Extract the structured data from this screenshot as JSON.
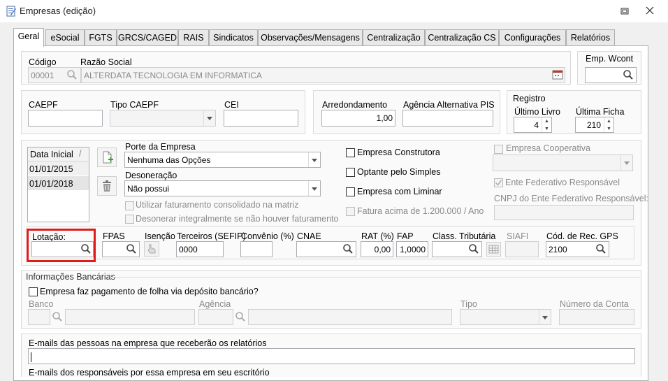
{
  "window": {
    "title": "Empresas (edição)"
  },
  "tabs": [
    {
      "label": "Geral"
    },
    {
      "label": "eSocial"
    },
    {
      "label": "FGTS"
    },
    {
      "label": "GRCS/CAGED"
    },
    {
      "label": "RAIS"
    },
    {
      "label": "Sindicatos"
    },
    {
      "label": "Observações/Mensagens"
    },
    {
      "label": "Centralização"
    },
    {
      "label": "Centralização CS"
    },
    {
      "label": "Configurações"
    },
    {
      "label": "Relatórios"
    }
  ],
  "company": {
    "codigo_label": "Código",
    "codigo_value": "00001",
    "razao_label": "Razão Social",
    "razao_value": "ALTERDATA TECNOLOGIA EM INFORMATICA",
    "wcont_label": "Emp. Wcont",
    "wcont_value": ""
  },
  "ids": {
    "caepf_label": "CAEPF",
    "caepf_value": "",
    "tipo_caepf_label": "Tipo CAEPF",
    "tipo_caepf_value": "",
    "cei_label": "CEI",
    "cei_value": ""
  },
  "arred": {
    "arred_label": "Arredondamento",
    "arred_value": "1,00",
    "agencia_pis_label": "Agência Alternativa PIS",
    "agencia_pis_value": ""
  },
  "registro": {
    "title": "Registro",
    "ultimo_livro_label": "Último Livro",
    "ultimo_livro_value": "4",
    "ultima_ficha_label": "Última Ficha",
    "ultima_ficha_value": "210"
  },
  "datas": {
    "header": "Data Inicial",
    "rows": [
      "01/01/2015",
      "01/01/2018"
    ]
  },
  "porte": {
    "label": "Porte da Empresa",
    "value": "Nenhuma das Opções"
  },
  "desoneracao": {
    "label": "Desoneração",
    "value": "Não possui"
  },
  "options": {
    "utilizar_fat": "Utilizar faturamento consolidado na matriz",
    "desonerar": "Desonerar integralmente se não houver faturamento",
    "construtora": "Empresa Construtora",
    "simples": "Optante pelo Simples",
    "liminar": "Empresa com Liminar",
    "fatura_acima": "Fatura acima de 1.200.000 / Ano",
    "cooperativa": "Empresa Cooperativa",
    "cooperativa_value": "",
    "ente_federativo": "Ente Federativo Responsável",
    "cnpj_ente_label": "CNPJ do Ente Federativo Responsável:",
    "cnpj_ente_value": ""
  },
  "fiscal": {
    "lotacao_label": "Lotação:",
    "lotacao_value": "",
    "fpas_label": "FPAS",
    "fpas_value": "",
    "isencao_label": "Isenção",
    "terceiros_label": "Terceiros (SEFIP)",
    "terceiros_value": "0000",
    "convenio_label": "Convênio (%)",
    "convenio_value": "",
    "cnae_label": "CNAE",
    "cnae_value": "",
    "rat_label": "RAT (%)",
    "rat_value": "0,00",
    "fap_label": "FAP",
    "fap_value": "1,0000",
    "class_trib_label": "Class. Tributária",
    "class_trib_value": "",
    "siafi_label": "SIAFI",
    "siafi_value": "",
    "cod_gps_label": "Cód. de Rec. GPS",
    "cod_gps_value": "2100"
  },
  "banco": {
    "section_title": "Informações Bancárias",
    "pagamento_label": "Empresa faz pagamento de folha via depósito bancário?",
    "banco_label": "Banco",
    "agencia_label": "Agência",
    "tipo_label": "Tipo",
    "numero_conta_label": "Número da Conta"
  },
  "emails": {
    "pessoas_label": "E-mails das pessoas na empresa que receberão os relatórios",
    "pessoas_value": "",
    "responsaveis_label": "E-mails dos responsáveis por essa empresa em seu escritório"
  },
  "colors": {
    "highlight": "#e11a1a",
    "tab_border": "#adadad"
  }
}
